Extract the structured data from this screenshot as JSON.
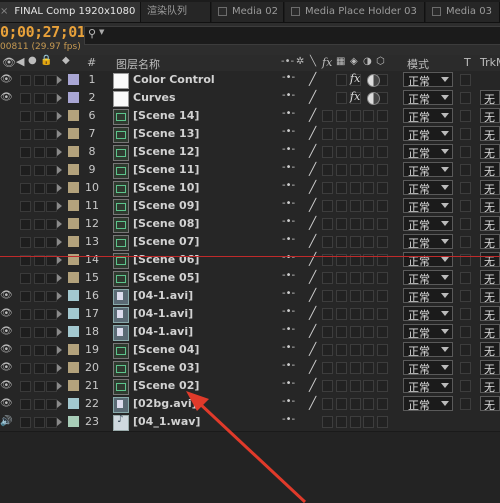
{
  "tabs": [
    {
      "label": "FINAL Comp 1920x1080",
      "active": true,
      "close": "×"
    },
    {
      "label": "渲染队列",
      "active": false
    },
    {
      "label": "Media 02",
      "active": false
    },
    {
      "label": "Media Place Holder 03",
      "active": false
    },
    {
      "label": "Media 03",
      "active": false
    }
  ],
  "timecode": "0;00;27;01",
  "frame_info": "00811 (29.97 fps)",
  "search": {
    "icon": "search-icon",
    "placeholder": ""
  },
  "columns": {
    "number": "#",
    "layer_name": "图层名称",
    "mode": "模式",
    "t": "T",
    "trkmat": "TrkM"
  },
  "colors": {
    "timecode": "#e8a13a",
    "playhead": "#c02a2a",
    "annotation_arrow": "#e03a2a"
  },
  "layers": [
    {
      "num": "1",
      "name": "Color Control",
      "label_color": "#a9a6d4",
      "icon": "solid-icon",
      "mode": "正常",
      "fx": "fx",
      "trkmat": "",
      "eye": true
    },
    {
      "num": "2",
      "name": "Curves",
      "label_color": "#a9a6d4",
      "icon": "solid-icon",
      "mode": "正常",
      "fx": "fx",
      "trkmat": "无",
      "eye": true
    },
    {
      "num": "6",
      "name": "[Scene 14]",
      "label_color": "#b3a27c",
      "icon": "composition-icon",
      "mode": "正常",
      "fx": "",
      "trkmat": "无",
      "eye": false
    },
    {
      "num": "7",
      "name": "[Scene 13]",
      "label_color": "#b3a27c",
      "icon": "composition-icon",
      "mode": "正常",
      "fx": "",
      "trkmat": "无",
      "eye": false
    },
    {
      "num": "8",
      "name": "[Scene 12]",
      "label_color": "#b3a27c",
      "icon": "composition-icon",
      "mode": "正常",
      "fx": "",
      "trkmat": "无",
      "eye": false
    },
    {
      "num": "9",
      "name": "[Scene 11]",
      "label_color": "#b3a27c",
      "icon": "composition-icon",
      "mode": "正常",
      "fx": "",
      "trkmat": "无",
      "eye": false
    },
    {
      "num": "10",
      "name": "[Scene 10]",
      "label_color": "#b3a27c",
      "icon": "composition-icon",
      "mode": "正常",
      "fx": "",
      "trkmat": "无",
      "eye": false
    },
    {
      "num": "11",
      "name": "[Scene 09]",
      "label_color": "#b3a27c",
      "icon": "composition-icon",
      "mode": "正常",
      "fx": "",
      "trkmat": "无",
      "eye": false
    },
    {
      "num": "12",
      "name": "[Scene 08]",
      "label_color": "#b3a27c",
      "icon": "composition-icon",
      "mode": "正常",
      "fx": "",
      "trkmat": "无",
      "eye": false
    },
    {
      "num": "13",
      "name": "[Scene 07]",
      "label_color": "#b3a27c",
      "icon": "composition-icon",
      "mode": "正常",
      "fx": "",
      "trkmat": "无",
      "eye": false
    },
    {
      "num": "14",
      "name": "[Scene 06]",
      "label_color": "#b3a27c",
      "icon": "composition-icon",
      "mode": "正常",
      "fx": "",
      "trkmat": "无",
      "eye": false
    },
    {
      "num": "15",
      "name": "[Scene 05]",
      "label_color": "#b3a27c",
      "icon": "composition-icon",
      "mode": "正常",
      "fx": "",
      "trkmat": "无",
      "eye": false
    },
    {
      "num": "16",
      "name": "[04-1.avi]",
      "label_color": "#a3c8cf",
      "icon": "film-icon",
      "mode": "正常",
      "fx": "",
      "trkmat": "无",
      "eye": true
    },
    {
      "num": "17",
      "name": "[04-1.avi]",
      "label_color": "#a3c8cf",
      "icon": "film-icon",
      "mode": "正常",
      "fx": "",
      "trkmat": "无",
      "eye": true
    },
    {
      "num": "18",
      "name": "[04-1.avi]",
      "label_color": "#a3c8cf",
      "icon": "film-icon",
      "mode": "正常",
      "fx": "",
      "trkmat": "无",
      "eye": true
    },
    {
      "num": "19",
      "name": "[Scene 04]",
      "label_color": "#b3a27c",
      "icon": "composition-icon",
      "mode": "正常",
      "fx": "",
      "trkmat": "无",
      "eye": true
    },
    {
      "num": "20",
      "name": "[Scene 03]",
      "label_color": "#b3a27c",
      "icon": "composition-icon",
      "mode": "正常",
      "fx": "",
      "trkmat": "无",
      "eye": true
    },
    {
      "num": "21",
      "name": "[Scene 02]",
      "label_color": "#b3a27c",
      "icon": "composition-icon",
      "mode": "正常",
      "fx": "",
      "trkmat": "无",
      "eye": true
    },
    {
      "num": "22",
      "name": "[02bg.avi]",
      "label_color": "#a3c8cf",
      "icon": "film-icon",
      "mode": "正常",
      "fx": "",
      "trkmat": "无",
      "eye": true
    },
    {
      "num": "23",
      "name": "[04_1.wav]",
      "label_color": "#a8cdb8",
      "icon": "audio-icon",
      "mode": "",
      "fx": "",
      "trkmat": "",
      "eye": false,
      "speaker": true
    }
  ]
}
